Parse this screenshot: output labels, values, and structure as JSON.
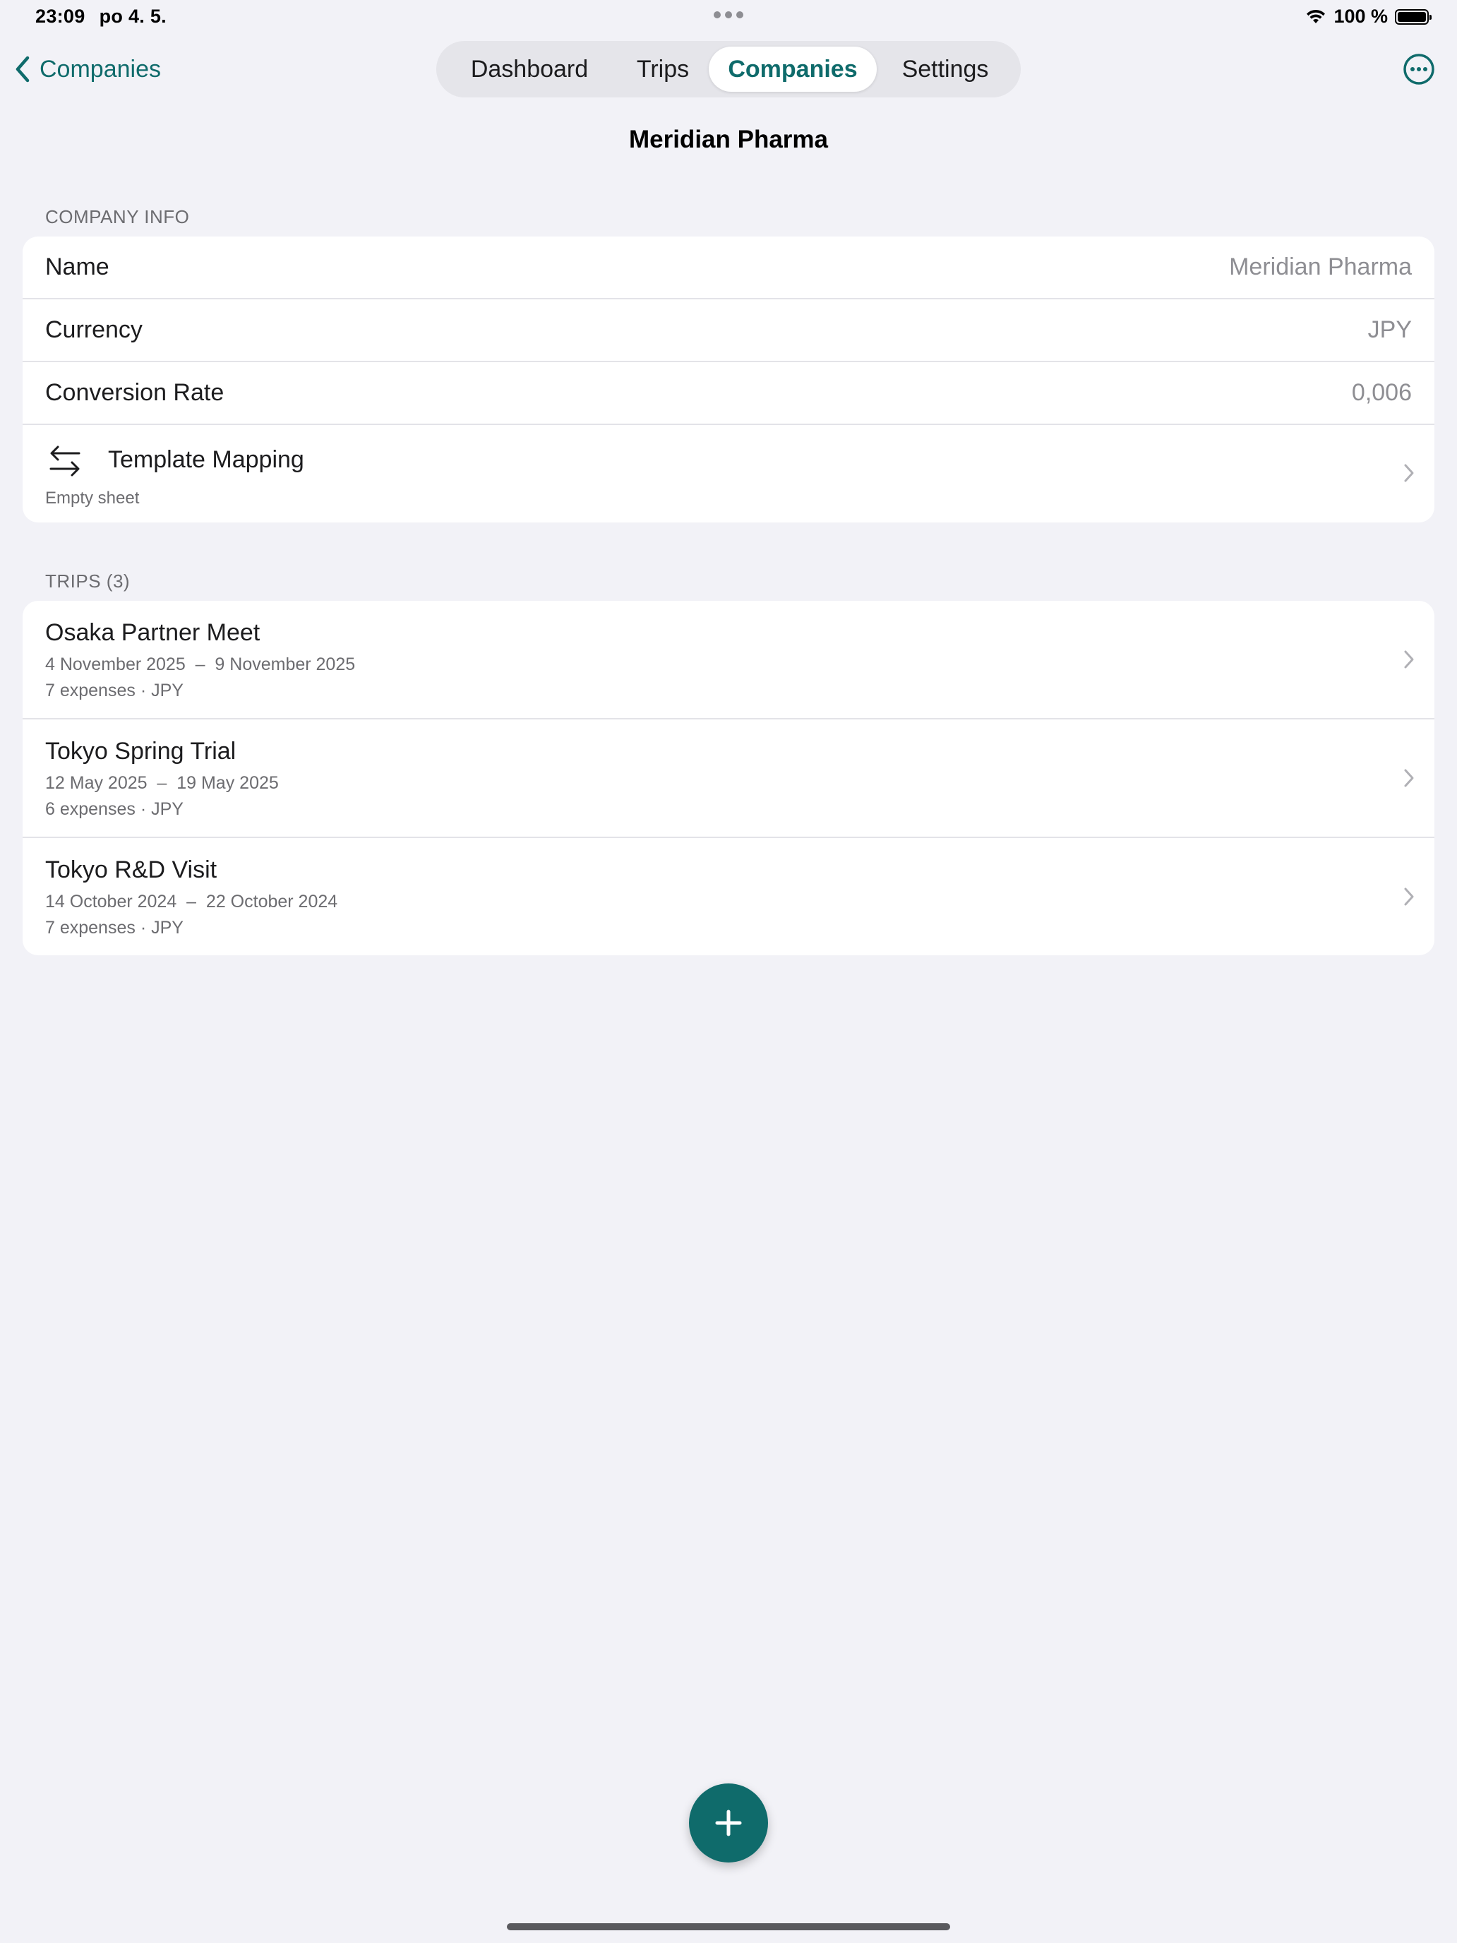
{
  "status_bar": {
    "time": "23:09",
    "date": "po 4. 5.",
    "battery_text": "100 %",
    "battery_level": 1.0
  },
  "nav": {
    "back_label": "Companies",
    "tabs": [
      {
        "label": "Dashboard",
        "active": false
      },
      {
        "label": "Trips",
        "active": false
      },
      {
        "label": "Companies",
        "active": true
      },
      {
        "label": "Settings",
        "active": false
      }
    ],
    "more_icon": "ellipsis-circle-icon"
  },
  "page": {
    "title": "Meridian Pharma"
  },
  "company_info": {
    "header": "COMPANY INFO",
    "rows": [
      {
        "label": "Name",
        "value": "Meridian Pharma"
      },
      {
        "label": "Currency",
        "value": "JPY"
      },
      {
        "label": "Conversion Rate",
        "value": "0,006"
      }
    ],
    "mapping": {
      "icon": "arrows-left-right-icon",
      "label": "Template Mapping",
      "subtitle": "Empty sheet"
    }
  },
  "trips": {
    "header": "TRIPS (3)",
    "items": [
      {
        "name": "Osaka Partner Meet",
        "dates": "4 November 2025  –  9 November 2025",
        "meta": "7 expenses · JPY"
      },
      {
        "name": "Tokyo Spring Trial",
        "dates": "12 May 2025  –  19 May 2025",
        "meta": "6 expenses · JPY"
      },
      {
        "name": "Tokyo R&D Visit",
        "dates": "14 October 2024  –  22 October 2024",
        "meta": "7 expenses · JPY"
      }
    ]
  },
  "fab_icon": "plus-icon",
  "colors": {
    "accent": "#0f6b6b",
    "background": "#f2f2f7",
    "card": "#ffffff",
    "secondary_text": "#8e8e93"
  }
}
